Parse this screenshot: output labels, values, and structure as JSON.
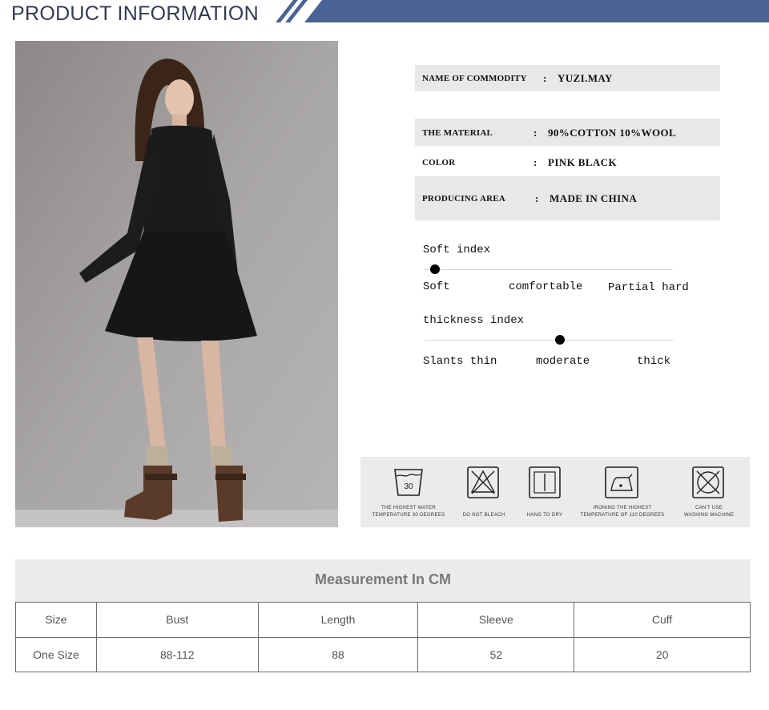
{
  "header": {
    "title": "PRODUCT INFORMATION",
    "banner_color": "#4a6396"
  },
  "specs": [
    {
      "label": "NAME OF COMMODITY",
      "colon": ":",
      "value": "YUZI.MAY"
    },
    {
      "label": "THE MATERIAL",
      "colon": ":",
      "value": "90%COTTON  10%WOOL"
    },
    {
      "label": "COLOR",
      "colon": ":",
      "value": "PINK  BLACK"
    },
    {
      "label": "PRODUCING AREA",
      "colon": ":",
      "value": "MADE IN CHINA"
    }
  ],
  "soft_index": {
    "title": "Soft index",
    "labels": [
      "Soft",
      "comfortable",
      "Partial hard"
    ],
    "level": 0
  },
  "thickness_index": {
    "title": "thickness index",
    "labels": [
      "Slants thin",
      "moderate",
      "thick"
    ],
    "level": 0.5
  },
  "care": [
    {
      "icon": "wash-30-icon",
      "number": "30",
      "line1": "THE HIGHEST WATER",
      "line2": "TEMPERATURE 30 DEGREES"
    },
    {
      "icon": "do-not-bleach-icon",
      "line1": "",
      "line2": "DO NOT BLEACH"
    },
    {
      "icon": "hang-to-dry-icon",
      "line1": "",
      "line2": "HANG TO DRY"
    },
    {
      "icon": "iron-110-icon",
      "line1": "IRONING THE HIGHEST",
      "line2": "TEMPERATURE OF 110 DEGREES"
    },
    {
      "icon": "no-machine-wash-icon",
      "line1": "CAN'T USE",
      "line2": "WASHING MACHINE"
    }
  ],
  "measurement": {
    "title": "Measurement In CM",
    "headers": [
      "Size",
      "Bust",
      "Length",
      "Sleeve",
      "Cuff"
    ],
    "rows": [
      [
        "One Size",
        "88-112",
        "88",
        "52",
        "20"
      ]
    ]
  }
}
